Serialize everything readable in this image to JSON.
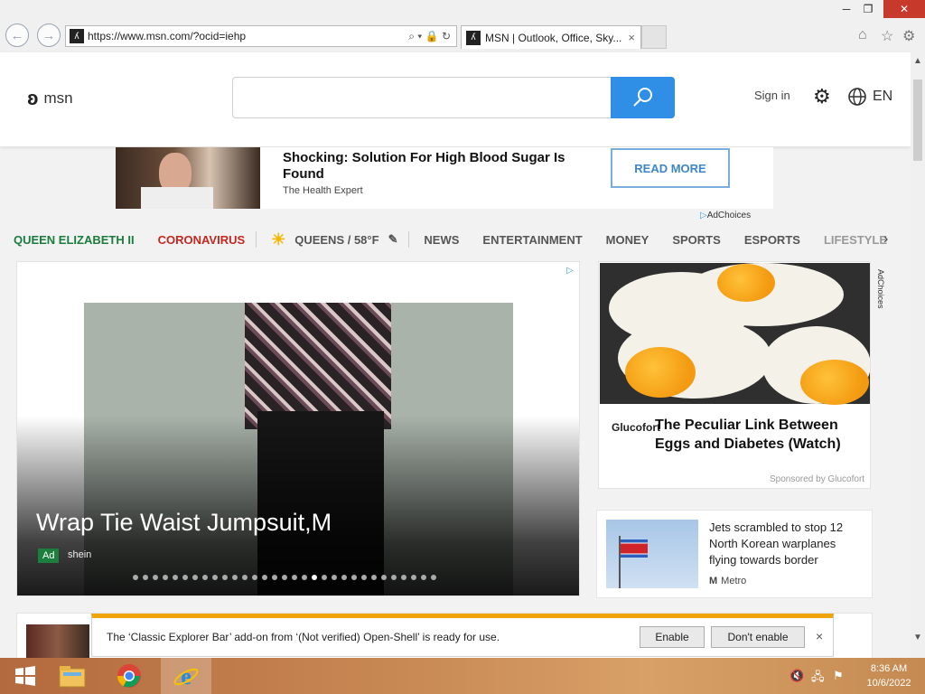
{
  "browser": {
    "url": "https://www.msn.com/?ocid=iehp",
    "tab_title": "MSN | Outlook, Office, Sky...",
    "tab_close": "×",
    "back_icon": "back-arrow-icon",
    "forward_icon": "forward-arrow-icon",
    "address_controls": "⌕ ▾ 🔒 ↻",
    "window_min": "─",
    "window_restore": "❐",
    "window_close": "✕"
  },
  "header": {
    "logo_text": "msn",
    "search_placeholder": "",
    "sign_in": "Sign in",
    "language": "EN"
  },
  "top_ad": {
    "headline": "Shocking: Solution For High Blood Sugar Is Found",
    "source": "The Health Expert",
    "cta": "READ MORE",
    "adchoices": "AdChoices"
  },
  "nav": {
    "items": [
      {
        "label": "QUEEN ELIZABETH II",
        "style": "green"
      },
      {
        "label": "CORONAVIRUS",
        "style": "red"
      }
    ],
    "weather": "QUEENS / 58°F",
    "sections": [
      "NEWS",
      "ENTERTAINMENT",
      "MONEY",
      "SPORTS",
      "ESPORTS",
      "LIFESTYLE"
    ]
  },
  "hero": {
    "title": "Wrap Tie Waist Jumpsuit,M",
    "badge": "Ad",
    "source": "shein",
    "dot_count": 31,
    "active_dot": 18
  },
  "right_ad": {
    "brand": "Glucofort",
    "headline": "The Peculiar Link Between Eggs and Diabetes (Watch)",
    "sponsored": "Sponsored by Glucofort",
    "adchoices": "AdChoices"
  },
  "news_card": {
    "headline": "Jets scrambled to stop 12 North Korean warplanes flying towards border",
    "source": "Metro"
  },
  "notification": {
    "message": "The ‘Classic Explorer Bar’ add-on from ‘(Not verified) Open-Shell’ is ready for use.",
    "enable": "Enable",
    "dont_enable": "Don't enable",
    "close": "×"
  },
  "taskbar": {
    "time": "8:36 AM",
    "date": "10/6/2022"
  },
  "colors": {
    "accent_blue": "#2f8ee5",
    "nav_green": "#1a7c3c",
    "nav_red": "#c4271f",
    "notify_bar": "#f0a30a"
  }
}
